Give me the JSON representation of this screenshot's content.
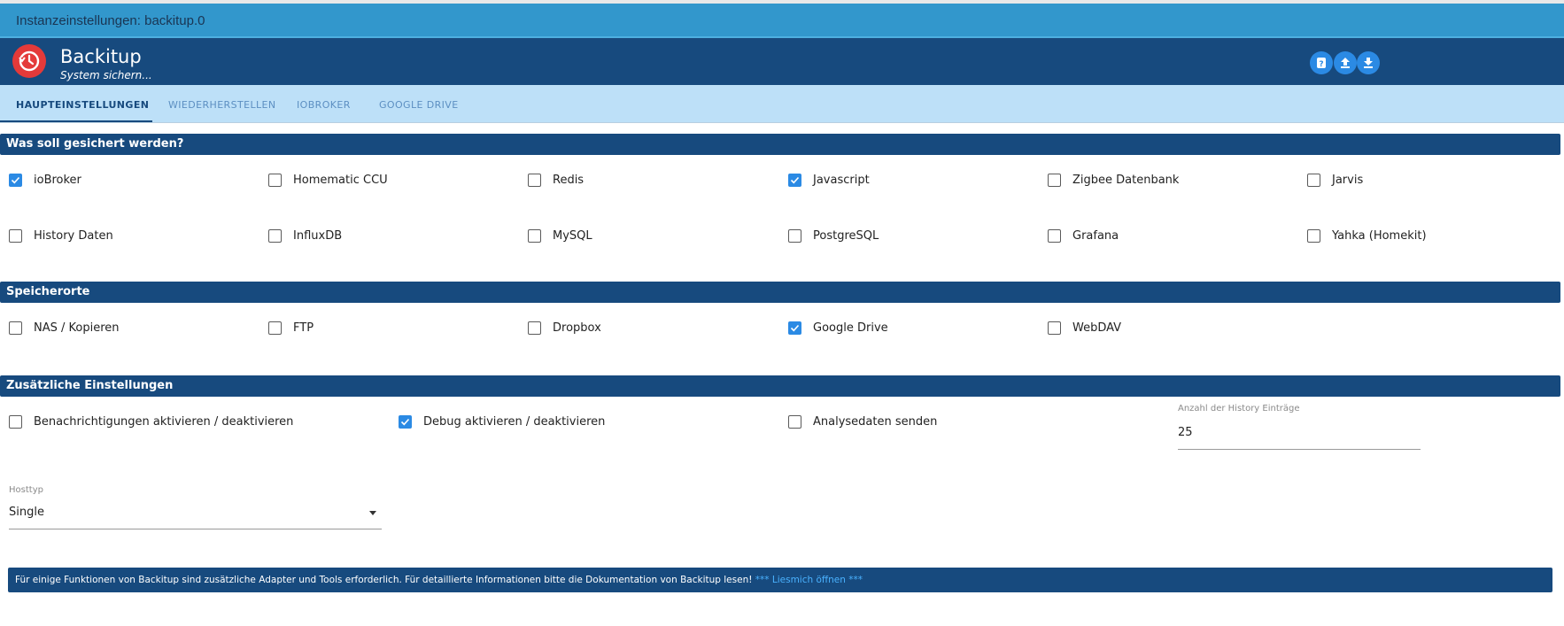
{
  "window": {
    "title": "Instanzeinstellungen: backitup.0"
  },
  "header": {
    "app_name": "Backitup",
    "subtitle": "System sichern...",
    "logo_icon": "clock-history-icon",
    "buttons": [
      "help-icon",
      "upload-icon",
      "download-icon"
    ]
  },
  "tabs": [
    {
      "label": "HAUPTEINSTELLUNGEN",
      "active": true
    },
    {
      "label": "WIEDERHERSTELLEN",
      "active": false
    },
    {
      "label": "IOBROKER",
      "active": false
    },
    {
      "label": "GOOGLE DRIVE",
      "active": false
    }
  ],
  "backup_section": {
    "title": "Was soll gesichert werden?",
    "items": [
      {
        "label": "ioBroker",
        "checked": true
      },
      {
        "label": "Homematic CCU",
        "checked": false
      },
      {
        "label": "Redis",
        "checked": false
      },
      {
        "label": "Javascript",
        "checked": true
      },
      {
        "label": "Zigbee Datenbank",
        "checked": false
      },
      {
        "label": "Jarvis",
        "checked": false
      },
      {
        "label": "History Daten",
        "checked": false
      },
      {
        "label": "InfluxDB",
        "checked": false
      },
      {
        "label": "MySQL",
        "checked": false
      },
      {
        "label": "PostgreSQL",
        "checked": false
      },
      {
        "label": "Grafana",
        "checked": false
      },
      {
        "label": "Yahka (Homekit)",
        "checked": false
      }
    ]
  },
  "storage_section": {
    "title": "Speicherorte",
    "items": [
      {
        "label": "NAS / Kopieren",
        "checked": false
      },
      {
        "label": "FTP",
        "checked": false
      },
      {
        "label": "Dropbox",
        "checked": false
      },
      {
        "label": "Google Drive",
        "checked": true
      },
      {
        "label": "WebDAV",
        "checked": false
      }
    ]
  },
  "extra_section": {
    "title": "Zusätzliche Einstellungen",
    "items": [
      {
        "label": "Benachrichtigungen aktivieren / deaktivieren",
        "checked": false
      },
      {
        "label": "Debug aktivieren / deaktivieren",
        "checked": true
      },
      {
        "label": "Analysedaten senden",
        "checked": false
      }
    ],
    "history_field": {
      "label": "Anzahl der History Einträge",
      "value": "25"
    },
    "hosttyp_field": {
      "label": "Hosttyp",
      "value": "Single"
    }
  },
  "info_bar": {
    "text": "Für einige Funktionen von Backitup sind zusätzliche Adapter und Tools erforderlich. Für detaillierte Informationen bitte die Dokumentation von Backitup lesen!",
    "link": "*** Liesmich öffnen ***"
  },
  "colors": {
    "primary": "#174a7e",
    "titlebar": "#3297cc",
    "tabbar": "#bde0f8",
    "checkbox": "#2b8ae4",
    "logo": "#e43a3a"
  }
}
